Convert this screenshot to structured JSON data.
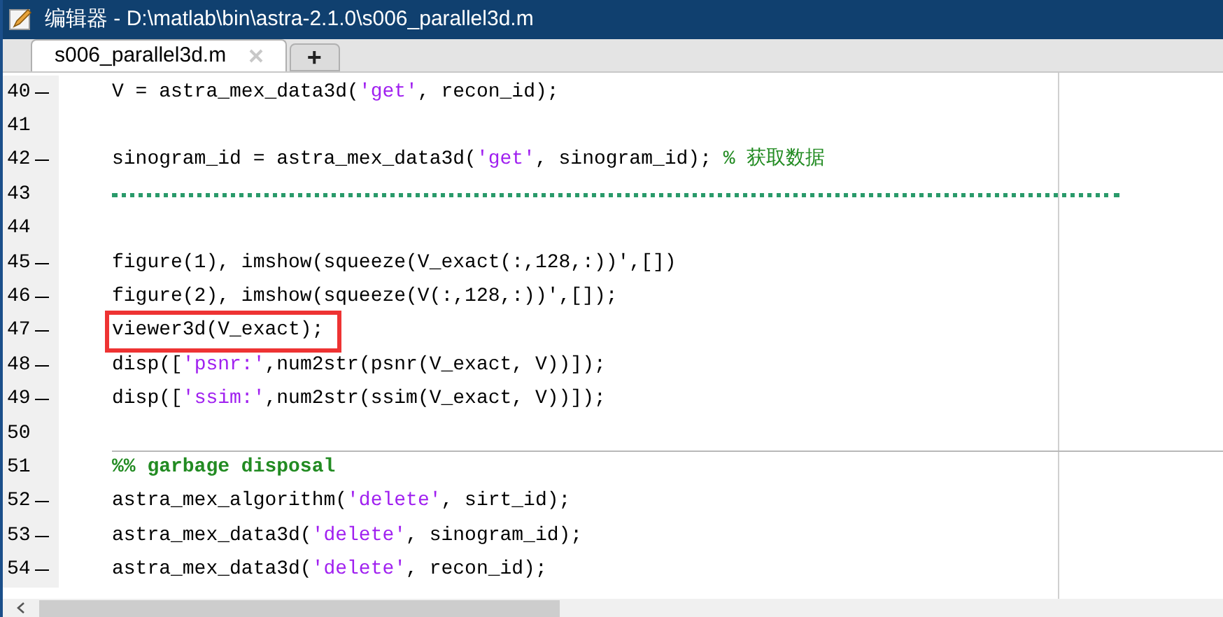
{
  "window": {
    "title": "编辑器 - D:\\matlab\\bin\\astra-2.1.0\\s006_parallel3d.m"
  },
  "tabs": [
    {
      "label": "s006_parallel3d.m",
      "selected": true
    }
  ],
  "new_tab_button": "+",
  "lines": [
    {
      "number": "40",
      "dash": true,
      "boxed": false,
      "segments": [
        {
          "kind": "plain",
          "text": "V = astra_mex_data3d("
        },
        {
          "kind": "string",
          "text": "'get'"
        },
        {
          "kind": "plain",
          "text": ", recon_id);"
        }
      ]
    },
    {
      "number": "41",
      "dash": false,
      "boxed": false
    },
    {
      "number": "42",
      "dash": true,
      "boxed": false,
      "segments": [
        {
          "kind": "plain",
          "text": "sinogram_id = astra_mex_data3d("
        },
        {
          "kind": "string",
          "text": "'get'"
        },
        {
          "kind": "plain",
          "text": ", sinogram_id); "
        },
        {
          "kind": "comment",
          "text": "% 获取数据"
        }
      ]
    },
    {
      "number": "43",
      "dash": false,
      "boxed": false,
      "segments": [
        {
          "kind": "dots"
        }
      ]
    },
    {
      "number": "44",
      "dash": false,
      "boxed": false
    },
    {
      "number": "45",
      "dash": true,
      "boxed": false,
      "segments": [
        {
          "kind": "plain",
          "text": "figure(1), imshow(squeeze(V_exact(:,128,:))',[])"
        }
      ]
    },
    {
      "number": "46",
      "dash": true,
      "boxed": false,
      "segments": [
        {
          "kind": "plain",
          "text": "figure(2), imshow(squeeze(V(:,128,:))',[]);"
        }
      ]
    },
    {
      "number": "47",
      "dash": true,
      "boxed": true,
      "segments": [
        {
          "kind": "plain",
          "text": "viewer3d(V_exact);"
        }
      ]
    },
    {
      "number": "48",
      "dash": true,
      "boxed": false,
      "segments": [
        {
          "kind": "plain",
          "text": "disp(["
        },
        {
          "kind": "string",
          "text": "'psnr:'"
        },
        {
          "kind": "plain",
          "text": ",num2str(psnr(V_exact, V))]);"
        }
      ]
    },
    {
      "number": "49",
      "dash": true,
      "boxed": false,
      "segments": [
        {
          "kind": "plain",
          "text": "disp(["
        },
        {
          "kind": "string",
          "text": "'ssim:'"
        },
        {
          "kind": "plain",
          "text": ",num2str(ssim(V_exact, V))]);"
        }
      ]
    },
    {
      "number": "50",
      "dash": false,
      "boxed": false
    },
    {
      "number": "51",
      "dash": false,
      "boxed": false,
      "segments": [
        {
          "kind": "section",
          "text": "%% garbage disposal"
        }
      ]
    },
    {
      "number": "52",
      "dash": true,
      "boxed": false,
      "segments": [
        {
          "kind": "plain",
          "text": "astra_mex_algorithm("
        },
        {
          "kind": "string",
          "text": "'delete'"
        },
        {
          "kind": "plain",
          "text": ", sirt_id);"
        }
      ]
    },
    {
      "number": "53",
      "dash": true,
      "boxed": false,
      "segments": [
        {
          "kind": "plain",
          "text": "astra_mex_data3d("
        },
        {
          "kind": "string",
          "text": "'delete'"
        },
        {
          "kind": "plain",
          "text": ", sinogram_id);"
        }
      ]
    },
    {
      "number": "54",
      "dash": true,
      "boxed": false,
      "segments": [
        {
          "kind": "plain",
          "text": "astra_mex_data3d("
        },
        {
          "kind": "string",
          "text": "'delete'"
        },
        {
          "kind": "plain",
          "text": ", recon_id);"
        }
      ]
    }
  ]
}
